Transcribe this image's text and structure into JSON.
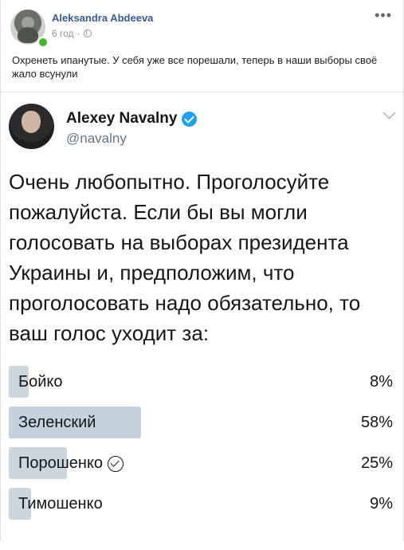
{
  "post": {
    "author": "Aleksandra Abdeeva",
    "time": "6 год",
    "separator": "·",
    "more_icon": "more-horizontal-icon",
    "text": "Охренеть ипанутые. У себя уже все порешали, теперь в наши выборы своё жало всунули",
    "link_color": "#385898"
  },
  "tweet": {
    "name": "Alexey Navalny",
    "handle": "@navalny",
    "verified_color": "#1da1f2",
    "text": "Очень любопытно. Проголосуйте пожалуйста. Если бы вы могли голосовать на выборах президента Украины и, предположим, что проголосовать надо обязательно, то ваш голос уходит за:",
    "poll": {
      "options": [
        {
          "label": "Бойко",
          "percent_text": "8%",
          "percent": 8,
          "selected": false
        },
        {
          "label": "Зеленский",
          "percent_text": "58%",
          "percent": 58,
          "selected": false
        },
        {
          "label": "Порошенко",
          "percent_text": "25%",
          "percent": 25,
          "selected": true
        },
        {
          "label": "Тимошенко",
          "percent_text": "9%",
          "percent": 9,
          "selected": false
        }
      ]
    }
  }
}
